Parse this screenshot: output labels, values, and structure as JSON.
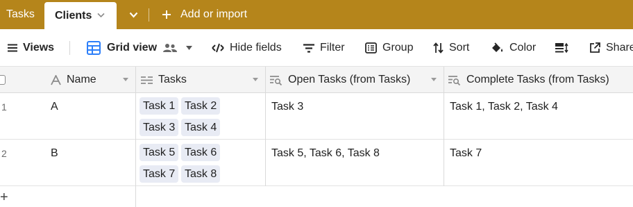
{
  "tabs": {
    "tasks_label": "Tasks",
    "clients_label": "Clients",
    "add_import_label": "Add or import"
  },
  "toolbar": {
    "views_label": "Views",
    "grid_view_label": "Grid view",
    "hide_fields_label": "Hide fields",
    "filter_label": "Filter",
    "group_label": "Group",
    "sort_label": "Sort",
    "color_label": "Color",
    "share_label": "Share"
  },
  "columns": {
    "name": "Name",
    "tasks": "Tasks",
    "open_tasks": "Open Tasks (from Tasks)",
    "complete_tasks": "Complete Tasks (from Tasks)"
  },
  "rows": [
    {
      "number": "1",
      "name": "A",
      "tasks": [
        "Task 1",
        "Task 2",
        "Task 3",
        "Task 4"
      ],
      "open_tasks": "Task 3",
      "complete_tasks": "Task 1, Task 2, Task 4"
    },
    {
      "number": "2",
      "name": "B",
      "tasks": [
        "Task 5",
        "Task 6",
        "Task 7",
        "Task 8"
      ],
      "open_tasks": "Task 5, Task 6, Task 8",
      "complete_tasks": "Task 7"
    }
  ],
  "add_row_label": "+",
  "colors": {
    "tab_bar": "#b5851b",
    "chip_background": "#e8ebf4",
    "grid_icon": "#2d7ff9"
  },
  "icons": {
    "add": "plus-icon",
    "views": "hamburger-icon",
    "grid": "grid-view-icon",
    "collaborators": "people-icon",
    "hide": "eye-slash-icon",
    "filter": "filter-icon",
    "group": "group-icon",
    "sort": "sort-icon",
    "color": "paint-bucket-icon",
    "row_height": "row-height-icon",
    "share": "share-icon"
  }
}
